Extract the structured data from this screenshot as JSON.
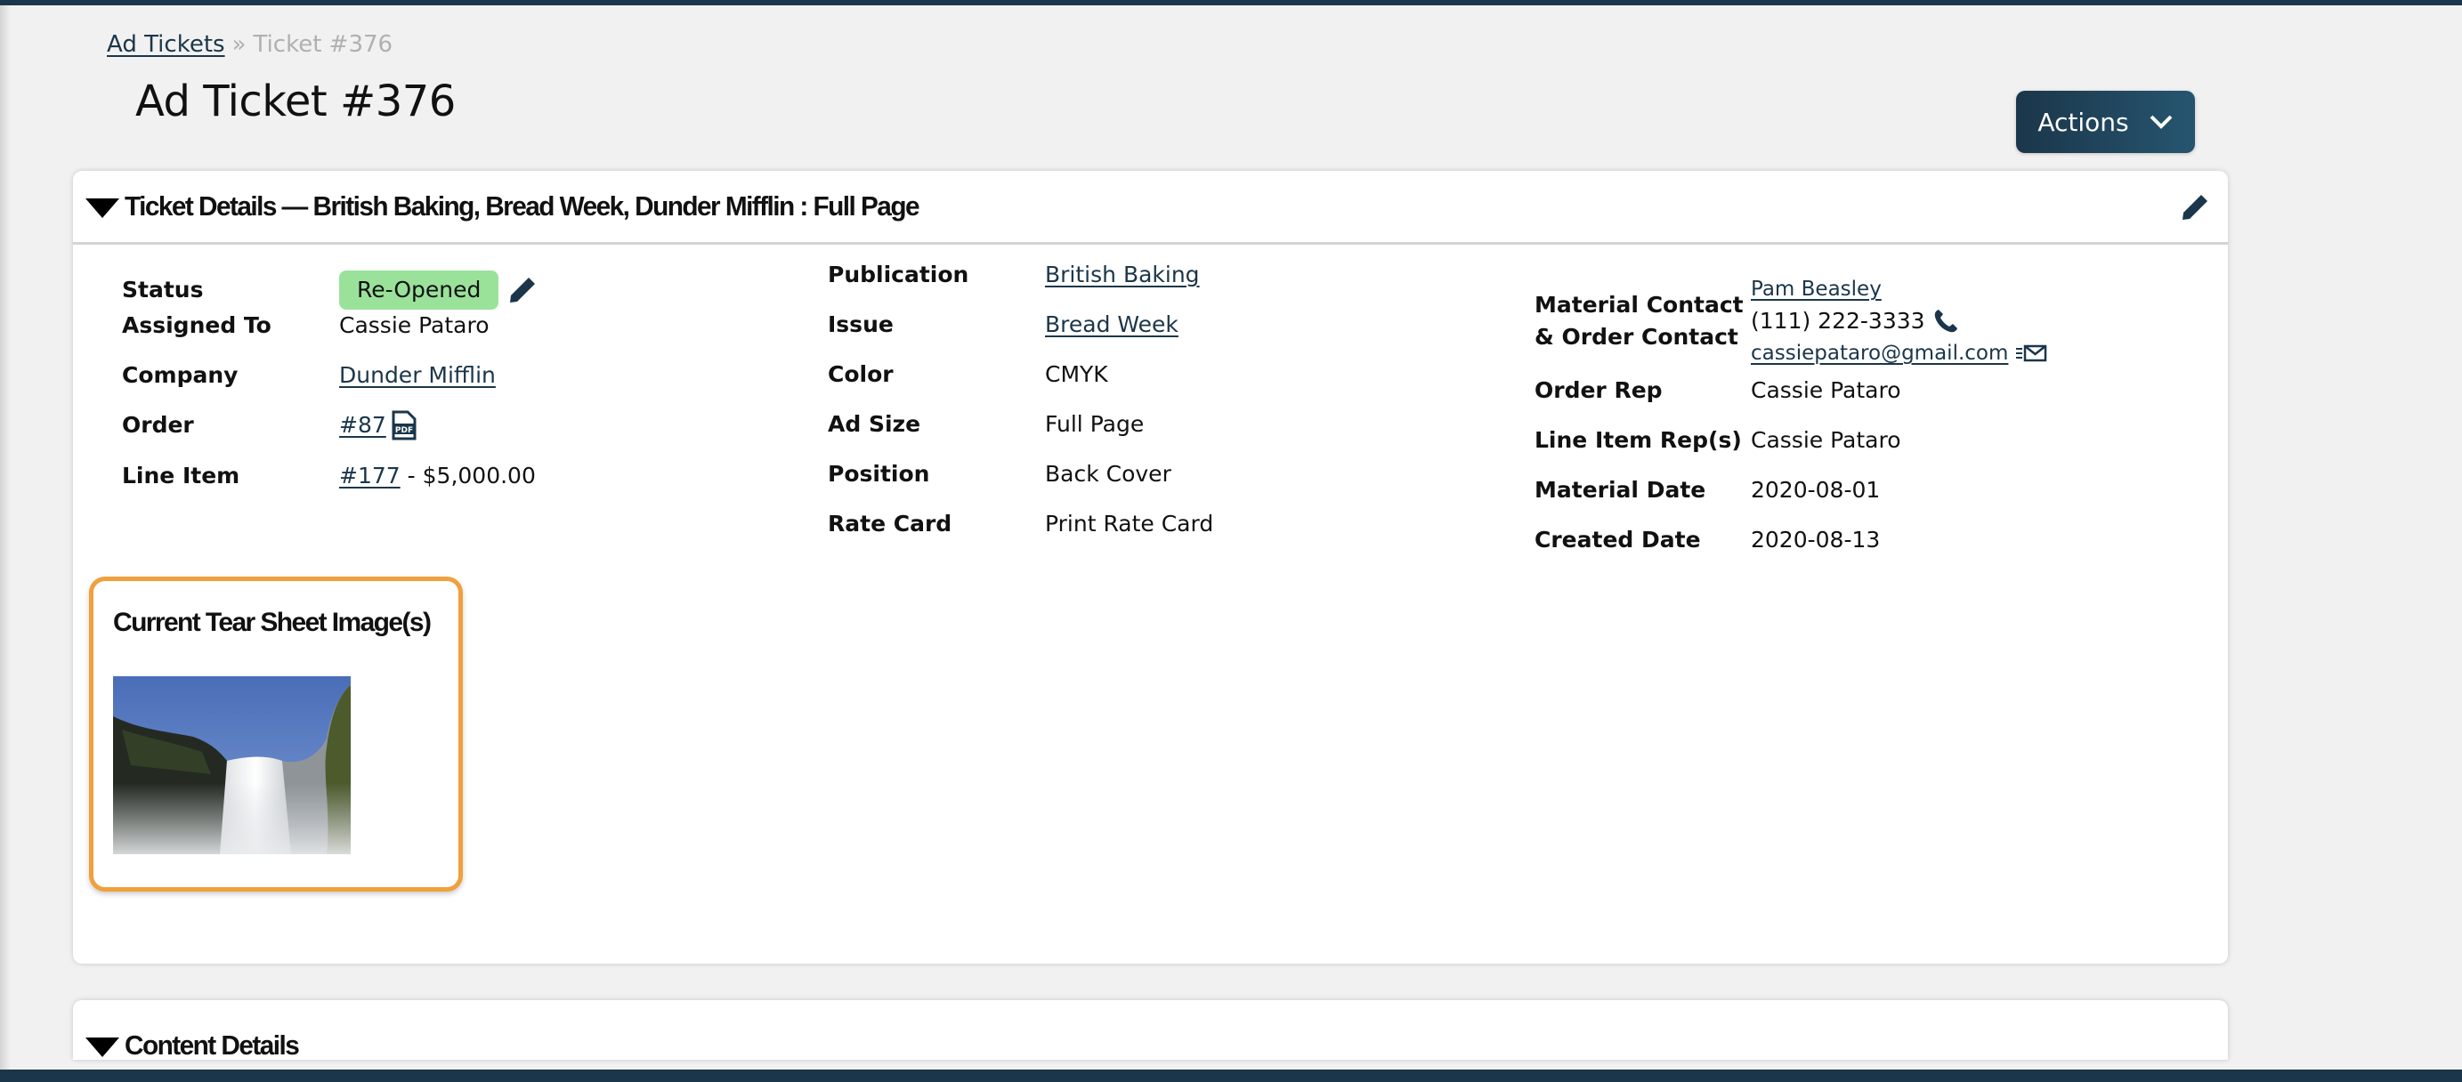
{
  "breadcrumb": {
    "parent": "Ad Tickets",
    "separator": "»",
    "current": "Ticket #376"
  },
  "page_title": "Ad Ticket #376",
  "actions_button": {
    "label": "Actions",
    "icon": "chevron-down-icon"
  },
  "ticket_details": {
    "title": "Ticket Details — British Baking, Bread Week, Dunder Mifflin : Full Page",
    "edit_icon": "pencil-icon",
    "column1": {
      "status": {
        "label": "Status",
        "value": "Re-Opened",
        "badge_color": "#9ae29a"
      },
      "assigned_to": {
        "label": "Assigned To",
        "value": "Cassie Pataro"
      },
      "company": {
        "label": "Company",
        "value": "Dunder Mifflin"
      },
      "order": {
        "label": "Order",
        "value": "#87",
        "icon": "pdf-icon"
      },
      "line_item": {
        "label": "Line Item",
        "value_link": "#177",
        "value_suffix": "- $5,000.00"
      }
    },
    "column2": {
      "publication": {
        "label": "Publication",
        "value": "British Baking"
      },
      "issue": {
        "label": "Issue",
        "value": "Bread Week"
      },
      "color": {
        "label": "Color",
        "value": "CMYK"
      },
      "ad_size": {
        "label": "Ad Size",
        "value": "Full Page"
      },
      "position": {
        "label": "Position",
        "value": "Back Cover"
      },
      "rate_card": {
        "label": "Rate Card",
        "value": "Print Rate Card"
      }
    },
    "column3": {
      "contact": {
        "label_line1": "Material Contact",
        "label_line2": "& Order Contact",
        "name": "Pam Beasley",
        "phone": "(111) 222-3333",
        "email": "cassiepataro@gmail.com"
      },
      "order_rep": {
        "label": "Order Rep",
        "value": "Cassie Pataro"
      },
      "line_item_reps": {
        "label": "Line Item Rep(s)",
        "value": "Cassie Pataro"
      },
      "material_date": {
        "label": "Material Date",
        "value": "2020-08-01"
      },
      "created_date": {
        "label": "Created Date",
        "value": "2020-08-13"
      }
    },
    "tear_sheet": {
      "title": "Current Tear Sheet Image(s)",
      "image_alt": "waterfall photo",
      "border_color": "#f0a03c"
    }
  },
  "content_details": {
    "title": "Content Details"
  },
  "colors": {
    "brand_dark": "#1b364a",
    "link": "#1b364a",
    "background": "#f1f1f1"
  }
}
